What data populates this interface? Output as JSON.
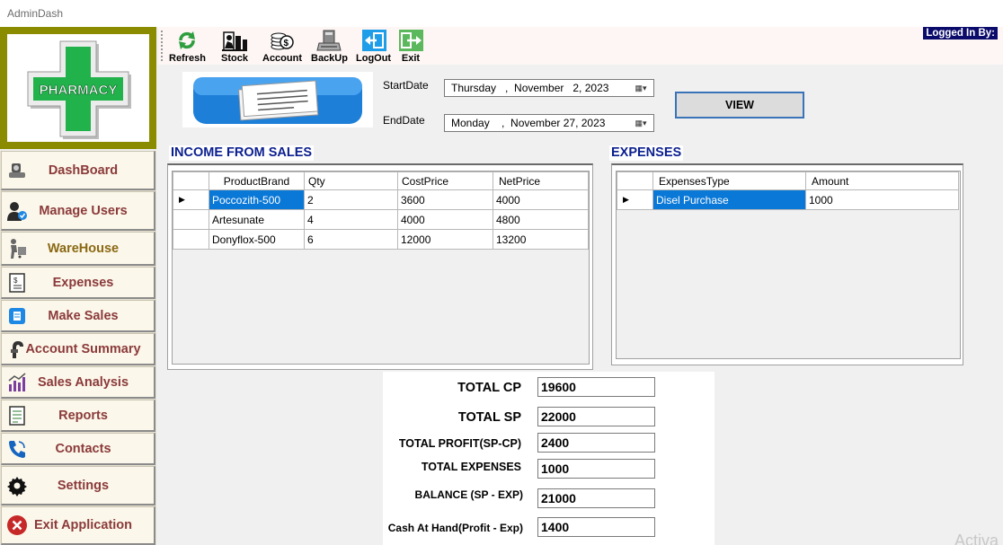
{
  "window": {
    "title": "AdminDash"
  },
  "logo": {
    "text": "PHARMACY"
  },
  "sidebar": {
    "items": [
      {
        "label": "DashBoard",
        "icon": "dashboard-icon"
      },
      {
        "label": "Manage Users",
        "icon": "users-icon"
      },
      {
        "label": "WareHouse",
        "icon": "warehouse-icon"
      },
      {
        "label": "Expenses",
        "icon": "expenses-icon"
      },
      {
        "label": "Make Sales",
        "icon": "sales-icon"
      },
      {
        "label": "Account Summary",
        "icon": "account-summary-icon"
      },
      {
        "label": "Sales Analysis",
        "icon": "chart-icon"
      },
      {
        "label": "Reports",
        "icon": "reports-icon"
      },
      {
        "label": "Contacts",
        "icon": "phone-icon"
      },
      {
        "label": "Settings",
        "icon": "gear-icon"
      },
      {
        "label": "Exit Application",
        "icon": "exit-icon"
      }
    ]
  },
  "toolbar": {
    "refresh": "Refresh",
    "stock": "Stock",
    "account": "Account",
    "backup": "BackUp",
    "logout": "LogOut",
    "exit": "Exit",
    "logged_in": "Logged In By:"
  },
  "filters": {
    "start_label": "StartDate",
    "start_value": "Thursday   ,  November   2, 2023",
    "end_label": "EndDate",
    "end_value": "Monday    ,  November 27, 2023",
    "view_button": "VIEW"
  },
  "income": {
    "title": "INCOME FROM SALES",
    "columns": [
      "ProductBrand",
      "Qty",
      "CostPrice",
      "NetPrice"
    ],
    "rows": [
      [
        "Poccozith-500",
        "2",
        "3600",
        "4000"
      ],
      [
        "Artesunate",
        "4",
        "4000",
        "4800"
      ],
      [
        "Donyflox-500",
        "6",
        "12000",
        "13200"
      ]
    ]
  },
  "expenses": {
    "title": "EXPENSES",
    "columns": [
      "ExpensesType",
      "Amount"
    ],
    "rows": [
      [
        "Disel Purchase",
        "1000"
      ]
    ]
  },
  "totals": {
    "total_cp_label": "TOTAL CP",
    "total_cp": "19600",
    "total_sp_label": "TOTAL SP",
    "total_sp": "22000",
    "total_profit_label": "TOTAL PROFIT(SP-CP)",
    "total_profit": "2400",
    "total_expenses_label": "TOTAL EXPENSES",
    "total_expenses": "1000",
    "balance_label": "BALANCE (SP - EXP)",
    "balance": "21000",
    "cash_label": "Cash At Hand(Profit - Exp)",
    "cash": "1400"
  },
  "watermark": "Activa",
  "colors": {
    "selection": "#0a78d7",
    "section_title": "#0b1f8f",
    "sidebar_text": "#8b3a3a",
    "logo_frame": "#8b8b00",
    "logged_in_bg": "#0b0b6b"
  }
}
